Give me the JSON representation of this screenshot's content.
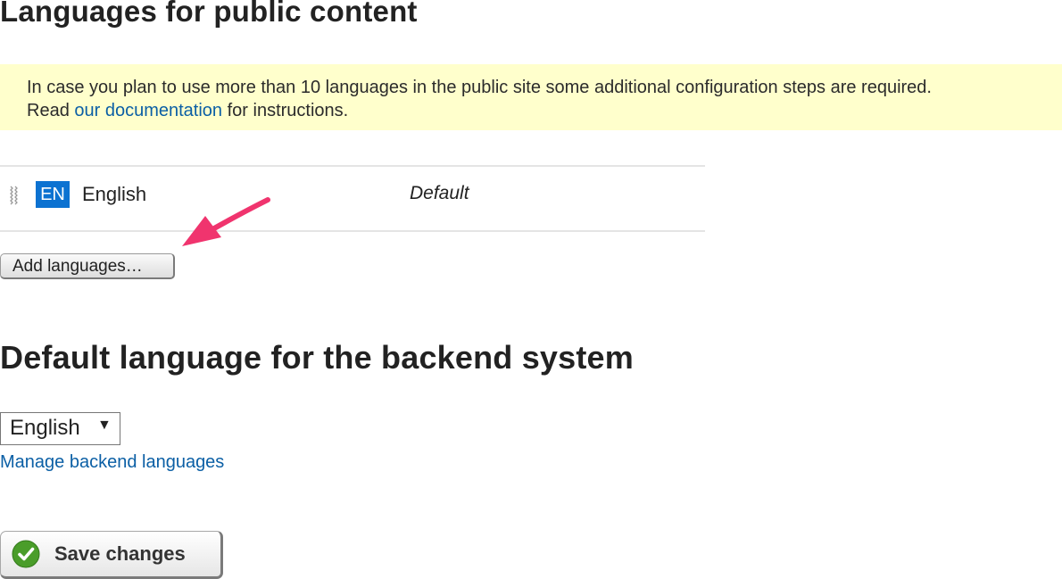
{
  "public_languages": {
    "heading": "Languages for public content",
    "notice": {
      "text_before": "In case you plan to use more than 10 languages in the public site some additional configuration steps are required.",
      "read": "Read",
      "link_text": "our documentation",
      "text_after": "for instructions."
    },
    "rows": [
      {
        "code": "EN",
        "name": "English",
        "status": "Default"
      }
    ],
    "add_button_label": "Add languages…"
  },
  "backend": {
    "heading": "Default language for the backend system",
    "select_value": "English",
    "manage_link": "Manage backend languages"
  },
  "save_button_label": "Save changes",
  "colors": {
    "notice_background": "#ffffcc",
    "link": "#0b5fa5",
    "badge": "#0c72d1",
    "annotation_arrow": "#f0346e",
    "save_check": "#4a9d2a"
  },
  "icons": {
    "drag_handle": "drag-handle-icon",
    "dropdown": "caret-down-icon",
    "save": "checkmark-icon",
    "annotation": "arrow-annotation-icon"
  }
}
